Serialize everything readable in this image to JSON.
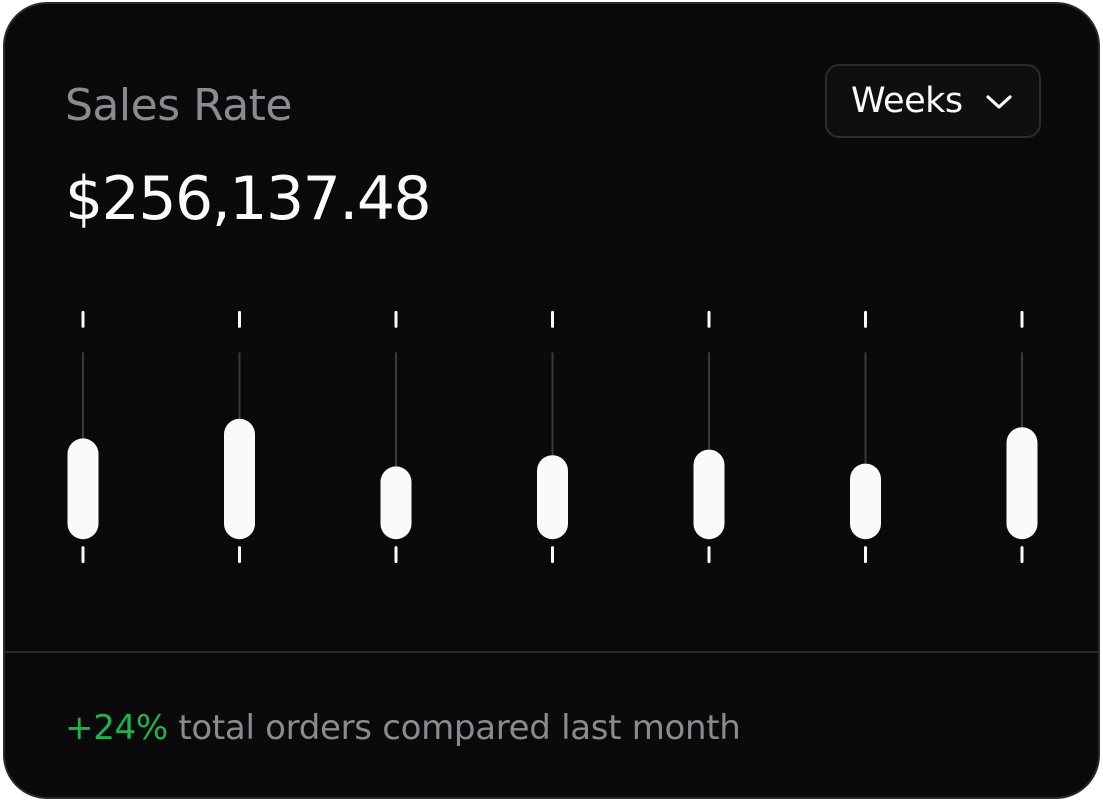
{
  "widget": {
    "title": "Sales Rate",
    "amount": "$256,137.48",
    "period_selector": {
      "selected": "Weeks",
      "icon": "chevron-down-icon"
    },
    "footer": {
      "change": "+24%",
      "text": " total orders compared last month"
    }
  },
  "colors": {
    "background": "#0a0a0b",
    "candle_fill": "#fafafa",
    "positive": "#22b14c",
    "muted_text": "#8a8a90"
  },
  "chart_data": {
    "type": "candlestick",
    "count": 7,
    "candles": [
      {
        "high": 0.92,
        "low": 0.08,
        "open": 0.52,
        "close": 0.16
      },
      {
        "high": 0.92,
        "low": 0.08,
        "open": 0.59,
        "close": 0.16
      },
      {
        "high": 0.92,
        "low": 0.08,
        "open": 0.42,
        "close": 0.16
      },
      {
        "high": 0.92,
        "low": 0.08,
        "open": 0.46,
        "close": 0.16
      },
      {
        "high": 0.92,
        "low": 0.08,
        "open": 0.48,
        "close": 0.16
      },
      {
        "high": 0.92,
        "low": 0.08,
        "open": 0.43,
        "close": 0.16
      },
      {
        "high": 0.92,
        "low": 0.08,
        "open": 0.56,
        "close": 0.16
      }
    ],
    "axes_visible": false,
    "grid": false,
    "legend": "none"
  }
}
